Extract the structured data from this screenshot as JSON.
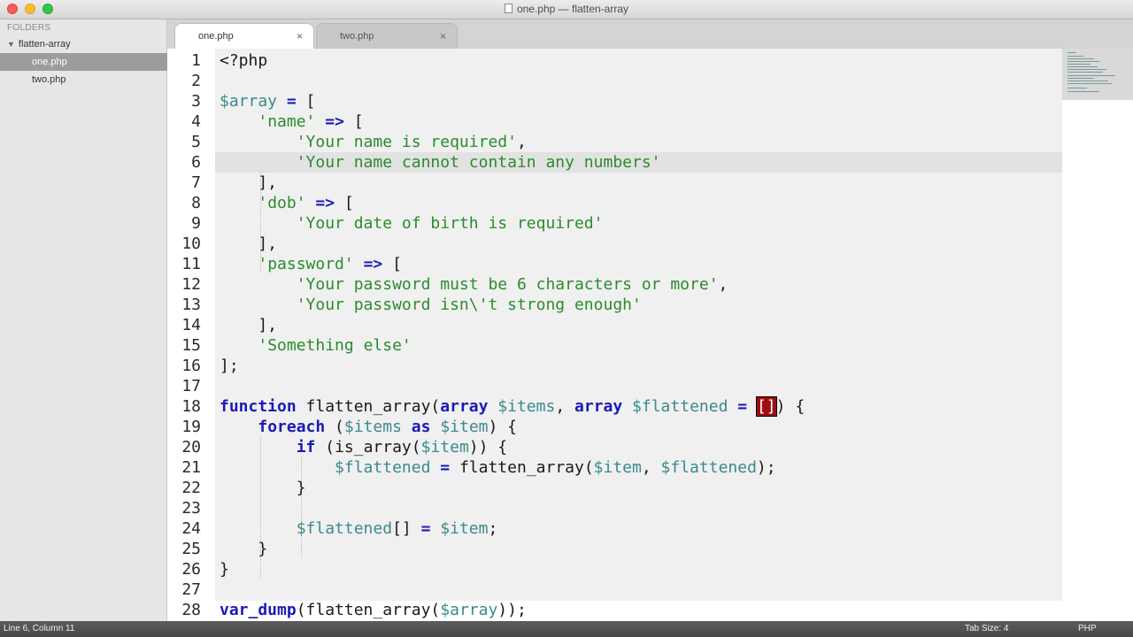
{
  "window": {
    "title": "one.php — flatten-array"
  },
  "sidebar": {
    "header": "FOLDERS",
    "folder": "flatten-array",
    "files": [
      {
        "name": "one.php",
        "selected": true
      },
      {
        "name": "two.php",
        "selected": false
      }
    ]
  },
  "tabs": [
    {
      "label": "one.php",
      "close": "×",
      "active": true
    },
    {
      "label": "two.php",
      "close": "×",
      "active": false
    }
  ],
  "editor": {
    "current_line": 6,
    "lines": [
      {
        "n": "1"
      },
      {
        "n": "2"
      },
      {
        "n": "3"
      },
      {
        "n": "4"
      },
      {
        "n": "5"
      },
      {
        "n": "6"
      },
      {
        "n": "7"
      },
      {
        "n": "8"
      },
      {
        "n": "9"
      },
      {
        "n": "10"
      },
      {
        "n": "11"
      },
      {
        "n": "12"
      },
      {
        "n": "13"
      },
      {
        "n": "14"
      },
      {
        "n": "15"
      },
      {
        "n": "16"
      },
      {
        "n": "17"
      },
      {
        "n": "18"
      },
      {
        "n": "19"
      },
      {
        "n": "20"
      },
      {
        "n": "21"
      },
      {
        "n": "22"
      },
      {
        "n": "23"
      },
      {
        "n": "24"
      },
      {
        "n": "25"
      },
      {
        "n": "26"
      },
      {
        "n": "27"
      },
      {
        "n": "28"
      }
    ],
    "code": {
      "l1": "<?php",
      "l3a": "$array",
      "l3b": " ",
      "l3c": "=",
      "l3d": " [",
      "l4a": "    ",
      "l4b": "'name'",
      "l4c": " ",
      "l4d": "=>",
      "l4e": " [",
      "l5a": "        ",
      "l5b": "'Your name is required'",
      "l5c": ",",
      "l6a": "        ",
      "l6b": "'Your name cannot contain any numbers'",
      "l7": "    ],",
      "l8a": "    ",
      "l8b": "'dob'",
      "l8c": " ",
      "l8d": "=>",
      "l8e": " [",
      "l9a": "        ",
      "l9b": "'Your date of birth is required'",
      "l10": "    ],",
      "l11a": "    ",
      "l11b": "'password'",
      "l11c": " ",
      "l11d": "=>",
      "l11e": " [",
      "l12a": "        ",
      "l12b": "'Your password must be 6 characters or more'",
      "l12c": ",",
      "l13a": "        ",
      "l13b": "'Your password isn\\'t strong enough'",
      "l14": "    ],",
      "l15a": "    ",
      "l15b": "'Something else'",
      "l16": "];",
      "l18a": "function",
      "l18b": " flatten_array(",
      "l18c": "array",
      "l18d": " ",
      "l18e": "$items",
      "l18f": ", ",
      "l18g": "array",
      "l18h": " ",
      "l18i": "$flattened",
      "l18j": " ",
      "l18k": "=",
      "l18l": " ",
      "l18m": "[]",
      "l18n": ") {",
      "l19a": "    ",
      "l19b": "foreach",
      "l19c": " (",
      "l19d": "$items",
      "l19e": " ",
      "l19f": "as",
      "l19g": " ",
      "l19h": "$item",
      "l19i": ") {",
      "l20a": "        ",
      "l20b": "if",
      "l20c": " (is_array(",
      "l20d": "$item",
      "l20e": ")) {",
      "l21a": "            ",
      "l21b": "$flattened",
      "l21c": " ",
      "l21d": "=",
      "l21e": " flatten_array(",
      "l21f": "$item",
      "l21g": ", ",
      "l21h": "$flattened",
      "l21i": ");",
      "l22": "        }",
      "l24a": "        ",
      "l24b": "$flattened",
      "l24c": "[] ",
      "l24d": "=",
      "l24e": " ",
      "l24f": "$item",
      "l24g": ";",
      "l25": "    }",
      "l26": "}",
      "l28a": "var_dump",
      "l28b": "(flatten_array(",
      "l28c": "$array",
      "l28d": "));"
    }
  },
  "status": {
    "position": "Line 6, Column 11",
    "tab_size": "Tab Size: 4",
    "syntax": "PHP"
  },
  "colors": {
    "keyword": "#1a1ab8",
    "string": "#2b8c2b",
    "variable": "#3a8a8c",
    "bracket_match": "#9e0f0f"
  }
}
